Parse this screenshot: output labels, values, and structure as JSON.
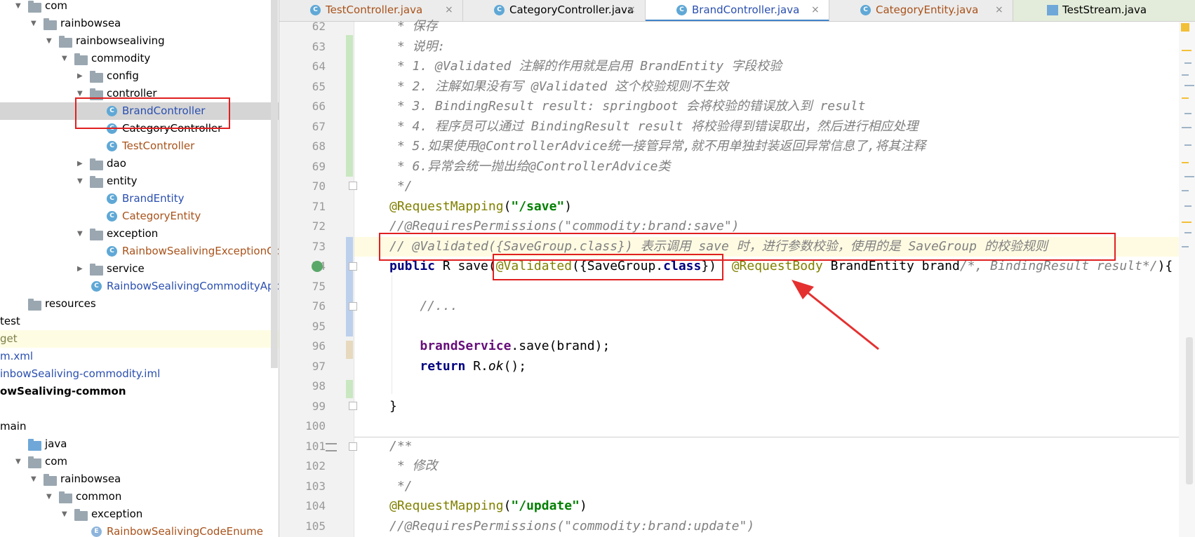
{
  "tree": {
    "rows": [
      {
        "label": "com",
        "indent": 0,
        "arrow": "down",
        "icon": "folder"
      },
      {
        "label": "rainbowsea",
        "indent": 1,
        "arrow": "down",
        "icon": "folder"
      },
      {
        "label": "rainbowsealiving",
        "indent": 2,
        "arrow": "down",
        "icon": "folder"
      },
      {
        "label": "commodity",
        "indent": 3,
        "arrow": "down",
        "icon": "folder"
      },
      {
        "label": "config",
        "indent": 4,
        "arrow": "right",
        "icon": "folder"
      },
      {
        "label": "controller",
        "indent": 4,
        "arrow": "down",
        "icon": "folder"
      },
      {
        "label": "BrandController",
        "indent": 5,
        "arrow": "",
        "icon": "class",
        "color": "blue",
        "selected": true
      },
      {
        "label": "CategoryController",
        "indent": 5,
        "arrow": "",
        "icon": "class"
      },
      {
        "label": "TestController",
        "indent": 5,
        "arrow": "",
        "icon": "class",
        "color": "brown"
      },
      {
        "label": "dao",
        "indent": 4,
        "arrow": "right",
        "icon": "folder"
      },
      {
        "label": "entity",
        "indent": 4,
        "arrow": "down",
        "icon": "folder"
      },
      {
        "label": "BrandEntity",
        "indent": 5,
        "arrow": "",
        "icon": "class",
        "color": "blue"
      },
      {
        "label": "CategoryEntity",
        "indent": 5,
        "arrow": "",
        "icon": "class",
        "color": "brown"
      },
      {
        "label": "exception",
        "indent": 4,
        "arrow": "down",
        "icon": "folder"
      },
      {
        "label": "RainbowSealivingExceptionContr",
        "indent": 5,
        "arrow": "",
        "icon": "class",
        "color": "brown"
      },
      {
        "label": "service",
        "indent": 4,
        "arrow": "right",
        "icon": "folder"
      },
      {
        "label": "RainbowSealivingCommodityApplica",
        "indent": 4,
        "arrow": "",
        "icon": "class",
        "color": "blue"
      },
      {
        "label": "resources",
        "indent": 0,
        "arrow": "",
        "icon": "folder"
      },
      {
        "label": "test",
        "indent": 0,
        "arrow": "",
        "icon": ""
      },
      {
        "label": "get",
        "indent": 0,
        "arrow": "",
        "icon": "",
        "color": "gray",
        "highlight": true
      },
      {
        "label": "m.xml",
        "indent": 0,
        "arrow": "",
        "icon": "",
        "color": "blue"
      },
      {
        "label": "inbowSealiving-commodity.iml",
        "indent": 0,
        "arrow": "",
        "icon": "",
        "color": "blue"
      },
      {
        "label": "owSealiving-common",
        "indent": 0,
        "arrow": "",
        "icon": "",
        "bold": true
      },
      {
        "label": "",
        "indent": 0,
        "arrow": "",
        "icon": ""
      },
      {
        "label": "main",
        "indent": 0,
        "arrow": "",
        "icon": ""
      },
      {
        "label": "java",
        "indent": 0,
        "arrow": "",
        "icon": "folder-blue"
      },
      {
        "label": "com",
        "indent": 0,
        "arrow": "down",
        "icon": "folder"
      },
      {
        "label": "rainbowsea",
        "indent": 1,
        "arrow": "down",
        "icon": "folder"
      },
      {
        "label": "common",
        "indent": 2,
        "arrow": "down",
        "icon": "folder"
      },
      {
        "label": "exception",
        "indent": 3,
        "arrow": "down",
        "icon": "folder"
      },
      {
        "label": "RainbowSealivingCodeEnume",
        "indent": 4,
        "arrow": "",
        "icon": "enum",
        "color": "brown"
      }
    ]
  },
  "tabs": [
    {
      "label": "TestController.java",
      "color": "brown",
      "close": "×"
    },
    {
      "label": "CategoryController.java",
      "color": "black",
      "close": "×"
    },
    {
      "label": "BrandController.java",
      "color": "blue",
      "close": "×",
      "active": true
    },
    {
      "label": "CategoryEntity.java",
      "color": "brown",
      "close": "×"
    },
    {
      "label": "TestStream.java",
      "color": "black",
      "close": ""
    }
  ],
  "code": {
    "lines": [
      {
        "num": "62",
        "segs": [
          {
            "t": " * 保存",
            "c": "cm"
          }
        ]
      },
      {
        "num": "63",
        "segs": [
          {
            "t": " * 说明:",
            "c": "cm"
          }
        ]
      },
      {
        "num": "64",
        "segs": [
          {
            "t": " * 1. @Validated 注解的作用就是启用 BrandEntity 字段校验",
            "c": "cm"
          }
        ]
      },
      {
        "num": "65",
        "segs": [
          {
            "t": " * 2. 注解如果没有写 @Validated 这个校验规则不生效",
            "c": "cm"
          }
        ]
      },
      {
        "num": "66",
        "segs": [
          {
            "t": " * 3. BindingResult result: springboot 会将校验的错误放入到 result",
            "c": "cm"
          }
        ]
      },
      {
        "num": "67",
        "segs": [
          {
            "t": " * 4. 程序员可以通过 BindingResult result 将校验得到错误取出，然后进行相应处理",
            "c": "cm"
          }
        ]
      },
      {
        "num": "68",
        "segs": [
          {
            "t": " * 5.如果使用@ControllerAdvice统一接管异常,就不用单独封装返回异常信息了,将其注释",
            "c": "cm"
          }
        ]
      },
      {
        "num": "69",
        "segs": [
          {
            "t": " * 6.异常会统一抛出给@ControllerAdvice类",
            "c": "cm"
          }
        ]
      },
      {
        "num": "70",
        "segs": [
          {
            "t": " */",
            "c": "cm"
          }
        ]
      },
      {
        "num": "71",
        "segs": [
          {
            "t": "@RequestMapping",
            "c": "an"
          },
          {
            "t": "(",
            "c": ""
          },
          {
            "t": "\"/save\"",
            "c": "st"
          },
          {
            "t": ")",
            "c": ""
          }
        ]
      },
      {
        "num": "72",
        "segs": [
          {
            "t": "//@RequiresPermissions(\"commodity:brand:save\")",
            "c": "cm"
          }
        ]
      },
      {
        "num": "73",
        "segs": [
          {
            "t": "// @Validated({SaveGroup.class}) 表示调用 save 时，进行参数校验，使用的是 SaveGroup 的校验规则",
            "c": "cm"
          }
        ]
      },
      {
        "num": "74",
        "segs": [
          {
            "t": "public ",
            "c": "kw"
          },
          {
            "t": "R save(",
            "c": ""
          },
          {
            "t": "@Validated",
            "c": "an"
          },
          {
            "t": "({SaveGroup.",
            "c": ""
          },
          {
            "t": "class",
            "c": "kw"
          },
          {
            "t": "})  ",
            "c": ""
          },
          {
            "t": "@RequestBody",
            "c": "an"
          },
          {
            "t": " BrandEntity brand",
            "c": ""
          },
          {
            "t": "/*, BindingResult result*/",
            "c": "cm"
          },
          {
            "t": "){",
            "c": ""
          }
        ]
      },
      {
        "num": "75",
        "segs": []
      },
      {
        "num": "76",
        "segs": [
          {
            "t": "    //...",
            "c": "cm"
          }
        ]
      },
      {
        "num": "95",
        "segs": []
      },
      {
        "num": "96",
        "segs": [
          {
            "t": "    ",
            "c": ""
          },
          {
            "t": "brandService",
            "c": "fld"
          },
          {
            "t": ".save(brand);",
            "c": ""
          }
        ]
      },
      {
        "num": "97",
        "segs": [
          {
            "t": "    ",
            "c": ""
          },
          {
            "t": "return ",
            "c": "kw"
          },
          {
            "t": "R.",
            "c": ""
          },
          {
            "t": "ok",
            "c": "cm"
          },
          {
            "t": "();",
            "c": ""
          }
        ]
      },
      {
        "num": "98",
        "segs": []
      },
      {
        "num": "99",
        "segs": [
          {
            "t": "}",
            "c": ""
          }
        ]
      },
      {
        "num": "100",
        "segs": []
      },
      {
        "num": "101",
        "segs": [
          {
            "t": "/**",
            "c": "cm"
          }
        ]
      },
      {
        "num": "102",
        "segs": [
          {
            "t": " * 修改",
            "c": "cm"
          }
        ]
      },
      {
        "num": "103",
        "segs": [
          {
            "t": " */",
            "c": "cm"
          }
        ]
      },
      {
        "num": "104",
        "segs": [
          {
            "t": "@RequestMapping",
            "c": "an"
          },
          {
            "t": "(",
            "c": ""
          },
          {
            "t": "\"/update\"",
            "c": "st"
          },
          {
            "t": ")",
            "c": ""
          }
        ]
      },
      {
        "num": "105",
        "segs": [
          {
            "t": "//@RequiresPermissions(\"commodity:brand:update\")",
            "c": "cm"
          }
        ]
      }
    ]
  },
  "colors": {
    "annotation_box": "#e02020",
    "arrow": "#e53030",
    "active_tab_underline": "#4083c9"
  }
}
